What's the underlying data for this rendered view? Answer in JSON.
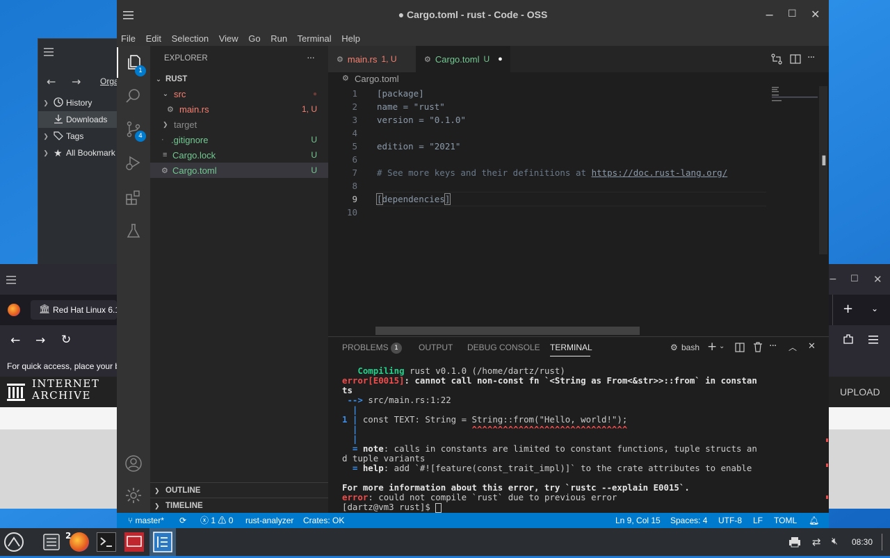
{
  "library": {
    "back_label": "←",
    "forward_label": "→",
    "organize_label": "Orga",
    "items": [
      {
        "label": "History"
      },
      {
        "label": "Downloads"
      },
      {
        "label": "Tags"
      },
      {
        "label": "All Bookmark"
      }
    ]
  },
  "firefox": {
    "tab_label": "Red Hat Linux 6.1",
    "bookmarks_hint": "For quick access, place your b",
    "ia_logo_line1": "INTERNET",
    "ia_logo_line2": "ARCHIVE",
    "upload_label": "UPLOAD"
  },
  "vscode": {
    "title": "● Cargo.toml - rust - Code - OSS",
    "menu": [
      "File",
      "Edit",
      "Selection",
      "View",
      "Go",
      "Run",
      "Terminal",
      "Help"
    ],
    "activity_badges": {
      "explorer": "1",
      "scm": "4"
    },
    "explorer": {
      "header": "EXPLORER",
      "more": "···",
      "root": "RUST",
      "items": [
        {
          "label": "src",
          "status": "●"
        },
        {
          "label": "main.rs",
          "status": "1, U"
        },
        {
          "label": "target",
          "status": ""
        },
        {
          "label": ".gitignore",
          "status": "U"
        },
        {
          "label": "Cargo.lock",
          "status": "U"
        },
        {
          "label": "Cargo.toml",
          "status": "U"
        }
      ],
      "outline": "OUTLINE",
      "timeline": "TIMELINE"
    },
    "tabs": [
      {
        "label": "main.rs",
        "status": "1, U"
      },
      {
        "label": "Cargo.toml",
        "status": "U"
      }
    ],
    "breadcrumb": "Cargo.toml",
    "code_lines": [
      {
        "num": "1",
        "text": "[package]",
        "cls": "default"
      },
      {
        "num": "2",
        "text": "name = \"rust\"",
        "cls": "default"
      },
      {
        "num": "3",
        "text": "version = \"0.1.0\"",
        "cls": "default"
      },
      {
        "num": "4",
        "text": "",
        "cls": "default"
      },
      {
        "num": "5",
        "text": "edition = \"2021\"",
        "cls": "default"
      },
      {
        "num": "6",
        "text": "",
        "cls": "default"
      },
      {
        "num": "7",
        "text": "# See more keys and their definitions at ",
        "cls": "comment",
        "link": "https://doc.rust-lang.org/"
      },
      {
        "num": "8",
        "text": "",
        "cls": "default"
      },
      {
        "num": "9",
        "text": "[dependencies]",
        "cls": "dep"
      },
      {
        "num": "10",
        "text": "",
        "cls": "default"
      }
    ],
    "panel": {
      "tabs": [
        "PROBLEMS",
        "OUTPUT",
        "DEBUG CONSOLE",
        "TERMINAL"
      ],
      "problems_count": "1",
      "shell": "bash",
      "terminal_lines": [
        {
          "parts": [
            {
              "t": "   ",
              "c": "#ccc"
            },
            {
              "t": "Compiling",
              "c": "#23d18b",
              "b": true
            },
            {
              "t": " rust v0.1.0 (/home/dartz/rust)",
              "c": "#ccc"
            }
          ]
        },
        {
          "parts": [
            {
              "t": "error[E0015]",
              "c": "#f14c4c",
              "b": true
            },
            {
              "t": ": cannot call non-const fn `<String as From<&str>>::from` in constan",
              "c": "#e5e5e5",
              "b": true
            }
          ]
        },
        {
          "parts": [
            {
              "t": "ts",
              "c": "#e5e5e5",
              "b": true
            }
          ]
        },
        {
          "parts": [
            {
              "t": " --> ",
              "c": "#3b8eea",
              "b": true
            },
            {
              "t": "src/main.rs:1:22",
              "c": "#ccc"
            }
          ]
        },
        {
          "parts": [
            {
              "t": "  |",
              "c": "#3b8eea",
              "b": true
            }
          ]
        },
        {
          "parts": [
            {
              "t": "1 | ",
              "c": "#3b8eea",
              "b": true
            },
            {
              "t": "const TEXT: String = String::from(\"Hello, world!\");",
              "c": "#ccc"
            }
          ]
        },
        {
          "parts": [
            {
              "t": "  | ",
              "c": "#3b8eea",
              "b": true
            },
            {
              "t": "                     ^^^^^^^^^^^^^^^^^^^^^^^^^^^^^^",
              "c": "#f14c4c",
              "b": true
            }
          ]
        },
        {
          "parts": [
            {
              "t": "  |",
              "c": "#3b8eea",
              "b": true
            }
          ]
        },
        {
          "parts": [
            {
              "t": "  = ",
              "c": "#3b8eea",
              "b": true
            },
            {
              "t": "note",
              "c": "#e5e5e5",
              "b": true
            },
            {
              "t": ": calls in constants are limited to constant functions, tuple structs an",
              "c": "#ccc"
            }
          ]
        },
        {
          "parts": [
            {
              "t": "d tuple variants",
              "c": "#ccc"
            }
          ]
        },
        {
          "parts": [
            {
              "t": "  = ",
              "c": "#3b8eea",
              "b": true
            },
            {
              "t": "help",
              "c": "#e5e5e5",
              "b": true
            },
            {
              "t": ": add `#![feature(const_trait_impl)]` to the crate attributes to enable",
              "c": "#ccc"
            }
          ]
        },
        {
          "parts": [
            {
              "t": "",
              "c": "#ccc"
            }
          ]
        },
        {
          "parts": [
            {
              "t": "For more information about this error, try `rustc --explain E0015`.",
              "c": "#e5e5e5",
              "b": true
            }
          ]
        },
        {
          "parts": [
            {
              "t": "error",
              "c": "#f14c4c",
              "b": true
            },
            {
              "t": ": could not compile `rust` due to previous error",
              "c": "#ccc"
            }
          ]
        },
        {
          "parts": [
            {
              "t": "[dartz@vm3 rust]$ ",
              "c": "#ccc"
            }
          ]
        }
      ]
    },
    "status": {
      "branch": "master*",
      "errors": "1",
      "warnings": "0",
      "analyzer": "rust-analyzer",
      "crates": "Crates: OK",
      "position": "Ln 9, Col 15",
      "spaces": "Spaces: 4",
      "encoding": "UTF-8",
      "eol": "LF",
      "language": "TOML"
    }
  },
  "taskbar": {
    "firefox_badge": "2",
    "clock": "08:30"
  },
  "colors": {
    "accent": "#007acc",
    "untracked": "#73c991",
    "error": "#f14c4c"
  }
}
